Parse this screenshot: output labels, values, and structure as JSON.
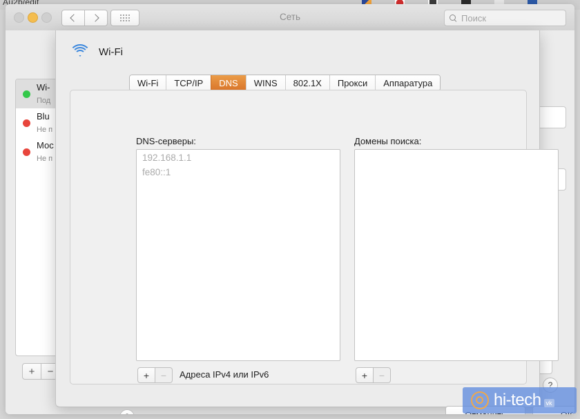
{
  "browser": {
    "tab_title_fragment": "Au2b/edit",
    "favicons": [
      "favicon-blue-orange",
      "favicon-red",
      "favicon-dark-box",
      "favicon-black-star",
      "favicon-grey",
      "favicon-blue"
    ]
  },
  "window": {
    "title": "Сеть",
    "traffic_lights": [
      "close",
      "minimize",
      "zoom"
    ],
    "nav": {
      "back": "‹",
      "forward": "›",
      "grid": "grid-view"
    },
    "search": {
      "placeholder": "Поиск",
      "value": ""
    }
  },
  "sidebar": {
    "services": [
      {
        "name": "Wi-",
        "status": "Под",
        "dot": "#34c84a",
        "selected": true
      },
      {
        "name": "Blu",
        "status": "Не п",
        "dot": "#e8453c",
        "selected": false
      },
      {
        "name": "Моc",
        "status": "Не п",
        "dot": "#e8453c",
        "selected": false
      }
    ],
    "add_label": "+",
    "remove_label": "−"
  },
  "background": {
    "help_label": "?"
  },
  "sheet": {
    "interface_name": "Wi-Fi",
    "interface_icon": "wifi-icon",
    "tabs": [
      {
        "label": "Wi-Fi",
        "active": false
      },
      {
        "label": "TCP/IP",
        "active": false
      },
      {
        "label": "DNS",
        "active": true
      },
      {
        "label": "WINS",
        "active": false
      },
      {
        "label": "802.1X",
        "active": false
      },
      {
        "label": "Прокси",
        "active": false
      },
      {
        "label": "Аппаратура",
        "active": false
      }
    ],
    "dns": {
      "label": "DNS-серверы:",
      "servers": [
        "192.168.1.1",
        "fe80::1"
      ],
      "add_label": "+",
      "remove_label": "−",
      "hint": "Адреса IPv4 или IPv6"
    },
    "domains": {
      "label": "Домены поиска:",
      "items": [],
      "add_label": "+",
      "remove_label": "−"
    },
    "help_label": "?",
    "cancel_label": "Отменить",
    "ok_label": "OK"
  },
  "watermark": {
    "text": "hi-tech",
    "badge": "vk",
    "accent": "#f0a84a",
    "background": "#608cde"
  },
  "colors": {
    "tab_active_top": "#eb9c48",
    "tab_active_bottom": "#d9752a",
    "window_bg": "#ececec",
    "status_green": "#34c84a",
    "status_red": "#e8453c"
  }
}
